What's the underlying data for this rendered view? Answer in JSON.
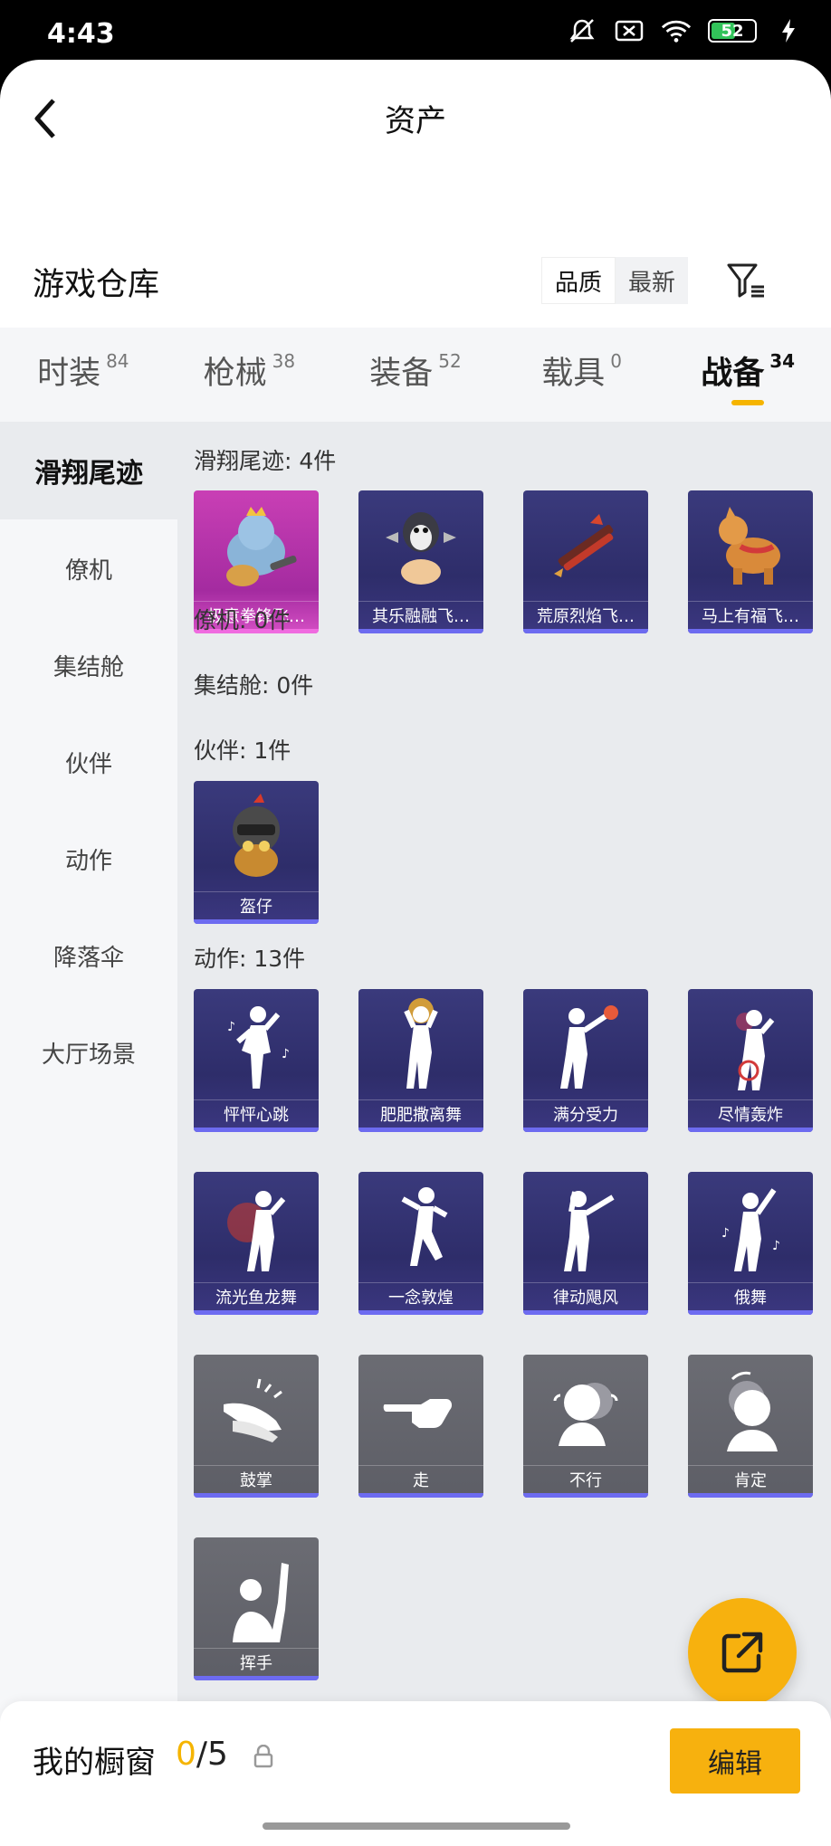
{
  "status": {
    "time": "4:43",
    "battery": "52"
  },
  "header": {
    "title": "资产"
  },
  "warehouse": {
    "title": "游戏仓库",
    "sort_quality": "品质",
    "sort_newest": "最新"
  },
  "tabs": [
    {
      "label": "时装",
      "count": "84"
    },
    {
      "label": "枪械",
      "count": "38"
    },
    {
      "label": "装备",
      "count": "52"
    },
    {
      "label": "载具",
      "count": "0"
    },
    {
      "label": "战备",
      "count": "34"
    }
  ],
  "sidebar": [
    "滑翔尾迹",
    "僚机",
    "集结舱",
    "伙伴",
    "动作",
    "降落伞",
    "大厅场景"
  ],
  "sections": {
    "glide": {
      "title": "滑翔尾迹: 4件",
      "items": [
        "极意拳锋飞…",
        "其乐融融飞…",
        "荒原烈焰飞…",
        "马上有福飞…"
      ]
    },
    "wingman": {
      "title": "僚机: 0件"
    },
    "capsule": {
      "title": "集结舱: 0件"
    },
    "partner": {
      "title": "伙伴: 1件",
      "items": [
        "盔仔"
      ]
    },
    "emote": {
      "title": "动作: 13件",
      "items": [
        "怦怦心跳",
        "肥肥撒离舞",
        "满分受力",
        "尽情轰炸",
        "流光鱼龙舞",
        "一念敦煌",
        "律动飓风",
        "俄舞",
        "鼓掌",
        "走",
        "不行",
        "肯定",
        "挥手"
      ]
    }
  },
  "bottom": {
    "label": "我的橱窗",
    "current": "0",
    "total": "/5",
    "edit": "编辑"
  }
}
